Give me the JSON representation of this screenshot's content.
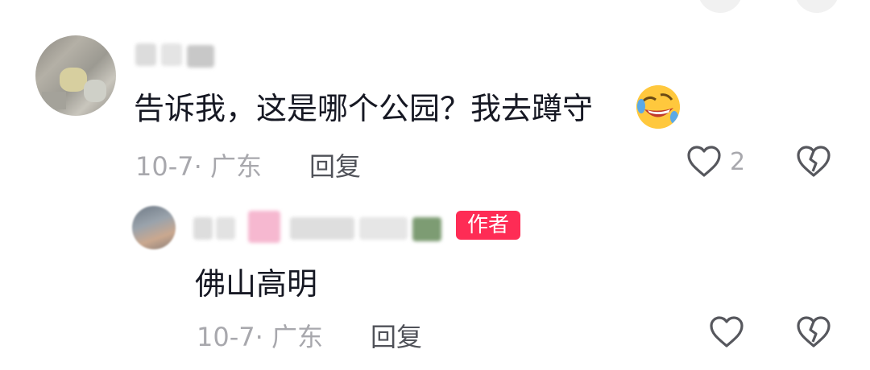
{
  "comment": {
    "text": "告诉我，这是哪个公园？我去蹲守",
    "emoji": "rolling-on-floor-laughing-emoji",
    "meta": "10-7· 广东",
    "reply_label": "回复",
    "like_count": "2"
  },
  "reply": {
    "badge": "作者",
    "text": "佛山高明",
    "meta": "10-7· 广东",
    "reply_label": "回复"
  },
  "colors": {
    "badge": "#fe2c55",
    "text": "#161823",
    "meta": "#a8a8ad"
  }
}
